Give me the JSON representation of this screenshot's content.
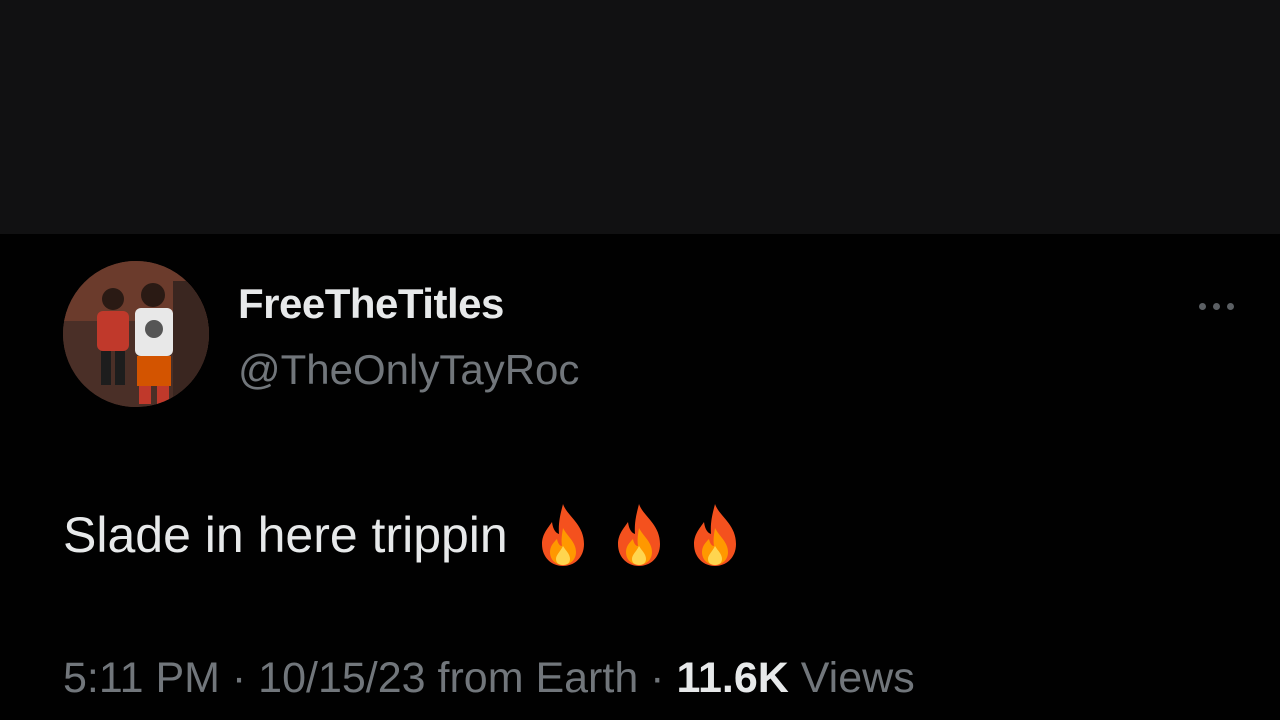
{
  "tweet": {
    "display_name": "FreeTheTitles",
    "handle": "@TheOnlyTayRoc",
    "text": "Slade in here trippin",
    "emoji": [
      "fire-emoji",
      "fire-emoji",
      "fire-emoji"
    ],
    "time": "5:11 PM",
    "sep1": " · ",
    "date": "10/15/23",
    "source": " from Earth",
    "sep2": " · ",
    "views_count": "11.6K",
    "views_label": " Views"
  },
  "icons": {
    "more": "more-horizontal-icon",
    "avatar": "avatar-image"
  },
  "colors": {
    "top_band": "#111112",
    "background": "#010101",
    "primary_text": "#e7e9ea",
    "secondary_text": "#71767b"
  }
}
